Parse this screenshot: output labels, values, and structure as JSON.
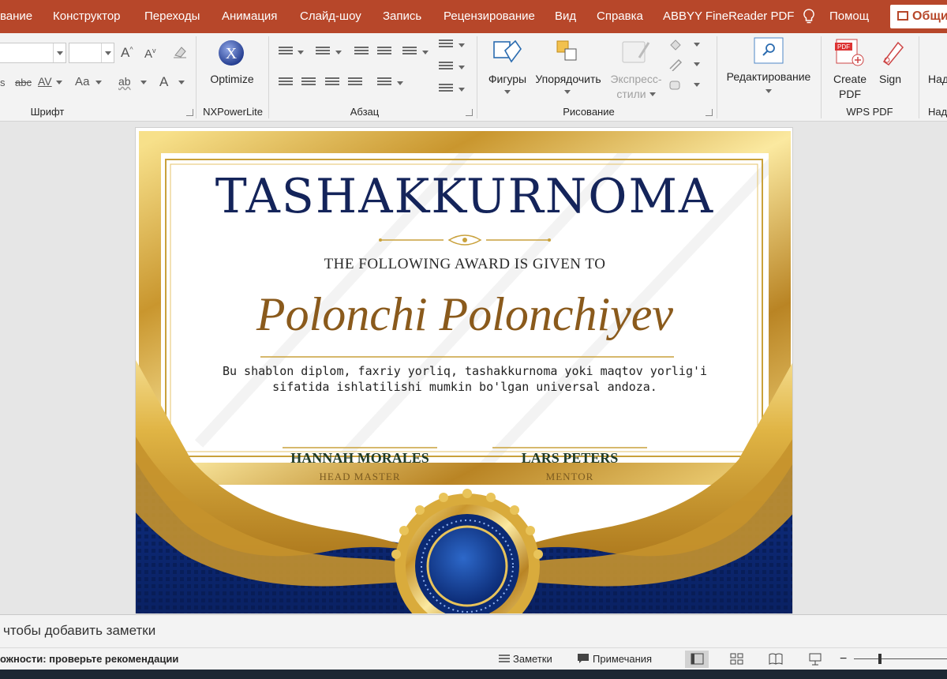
{
  "tabs": {
    "items": [
      {
        "label": "вание"
      },
      {
        "label": "Конструктор"
      },
      {
        "label": "Переходы"
      },
      {
        "label": "Анимация"
      },
      {
        "label": "Слайд-шоу"
      },
      {
        "label": "Запись"
      },
      {
        "label": "Рецензирование"
      },
      {
        "label": "Вид"
      },
      {
        "label": "Справка"
      },
      {
        "label": "ABBYY FineReader PDF"
      }
    ],
    "tell_me": "Помощ",
    "share": "Общи"
  },
  "ribbon": {
    "font_group": "Шрифт",
    "font_case_label": "Аа",
    "font_strike_label": "abc",
    "font_spacing_label": "AV",
    "font_grow_label": "A",
    "nxpowerlite_group": "NXPowerLite",
    "optimize_label": "Optimize",
    "paragraph_group": "Абзац",
    "drawing_group": "Рисование",
    "shapes_label": "Фигуры",
    "arrange_label": "Упорядочить",
    "quick_styles_label_1": "Экспресс-",
    "quick_styles_label_2": "стили",
    "editing_label": "Редактирование",
    "wps_group": "WPS PDF",
    "create_pdf_label_1": "Create",
    "create_pdf_label_2": "PDF",
    "sign_label": "Sign",
    "next_group_label": "Над",
    "next_group_title": "Над"
  },
  "slide": {
    "title": "TASHAKKURNOMA",
    "subtitle": "THE FOLLOWING AWARD IS GIVEN TO",
    "recipient": "Polonchi Polonchiyev",
    "description_line1": "Bu shablon diplom, faxriy yorliq, tashakkurnoma yoki maqtov yorlig'i",
    "description_line2": "sifatida ishlatilishi mumkin bo'lgan universal andoza.",
    "signer1_name": "HANNAH MORALES",
    "signer1_role": "HEAD MASTER",
    "signer2_name": "LARS PETERS",
    "signer2_role": "MENTOR"
  },
  "notes": {
    "placeholder": "чтобы добавить заметки"
  },
  "status": {
    "accessibility": "ожности: проверьте рекомендации",
    "notes_button": "Заметки",
    "comments_button": "Примечания",
    "zoom_minus": "−"
  },
  "colors": {
    "accent_red": "#b7472a",
    "certificate_navy": "#14245a",
    "certificate_gold": "#c9a13b",
    "certificate_blue": "#0d2a7a"
  }
}
